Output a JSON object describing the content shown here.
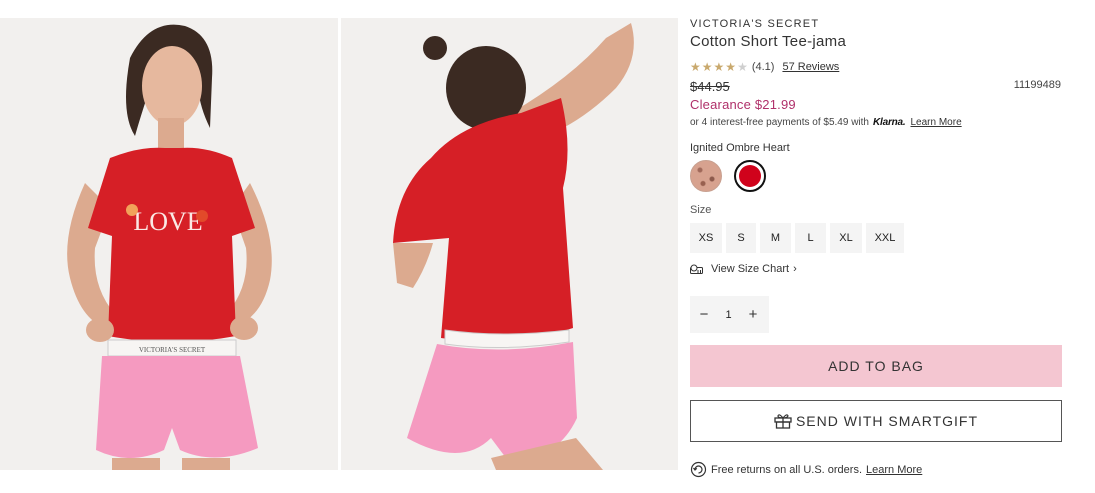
{
  "product": {
    "brand": "VICTORIA'S SECRET",
    "title": "Cotton Short Tee-jama",
    "rating": {
      "value": 4.1,
      "text": "(4.1)",
      "stars_filled": 4,
      "stars_total": 5,
      "reviews_text": "57 Reviews"
    },
    "original_price": "$44.95",
    "sku": "11199489",
    "clearance_text": "Clearance $21.99",
    "installments": {
      "prefix": "or 4 interest-free payments of $5.49 with",
      "provider": "Klarna.",
      "link": "Learn More"
    },
    "color": {
      "selected_name": "Ignited Ombre Heart",
      "swatches": [
        {
          "id": "leopard",
          "selected": false
        },
        {
          "id": "red",
          "hex": "#d0021b",
          "selected": true
        }
      ]
    },
    "size": {
      "label": "Size",
      "options": [
        "XS",
        "S",
        "M",
        "L",
        "XL",
        "XXL"
      ],
      "chart_link": "View Size Chart"
    },
    "quantity": {
      "value": "1",
      "minus": "−",
      "plus": "+"
    },
    "add_to_bag": "ADD TO BAG",
    "smartgift": "SEND WITH SMARTGIFT",
    "returns": {
      "text": "Free returns on all U.S. orders.",
      "link": "Learn More"
    },
    "images": {
      "front_shirt_text": "LOVE",
      "waistband_text": "VICTORIA'S SECRET"
    }
  },
  "colors": {
    "accent_pink": "#f4c6d1",
    "clearance": "#b0306a",
    "star": "#c9a96e",
    "shirt_red": "#d61f26",
    "shorts_pink": "#f59ac0"
  }
}
